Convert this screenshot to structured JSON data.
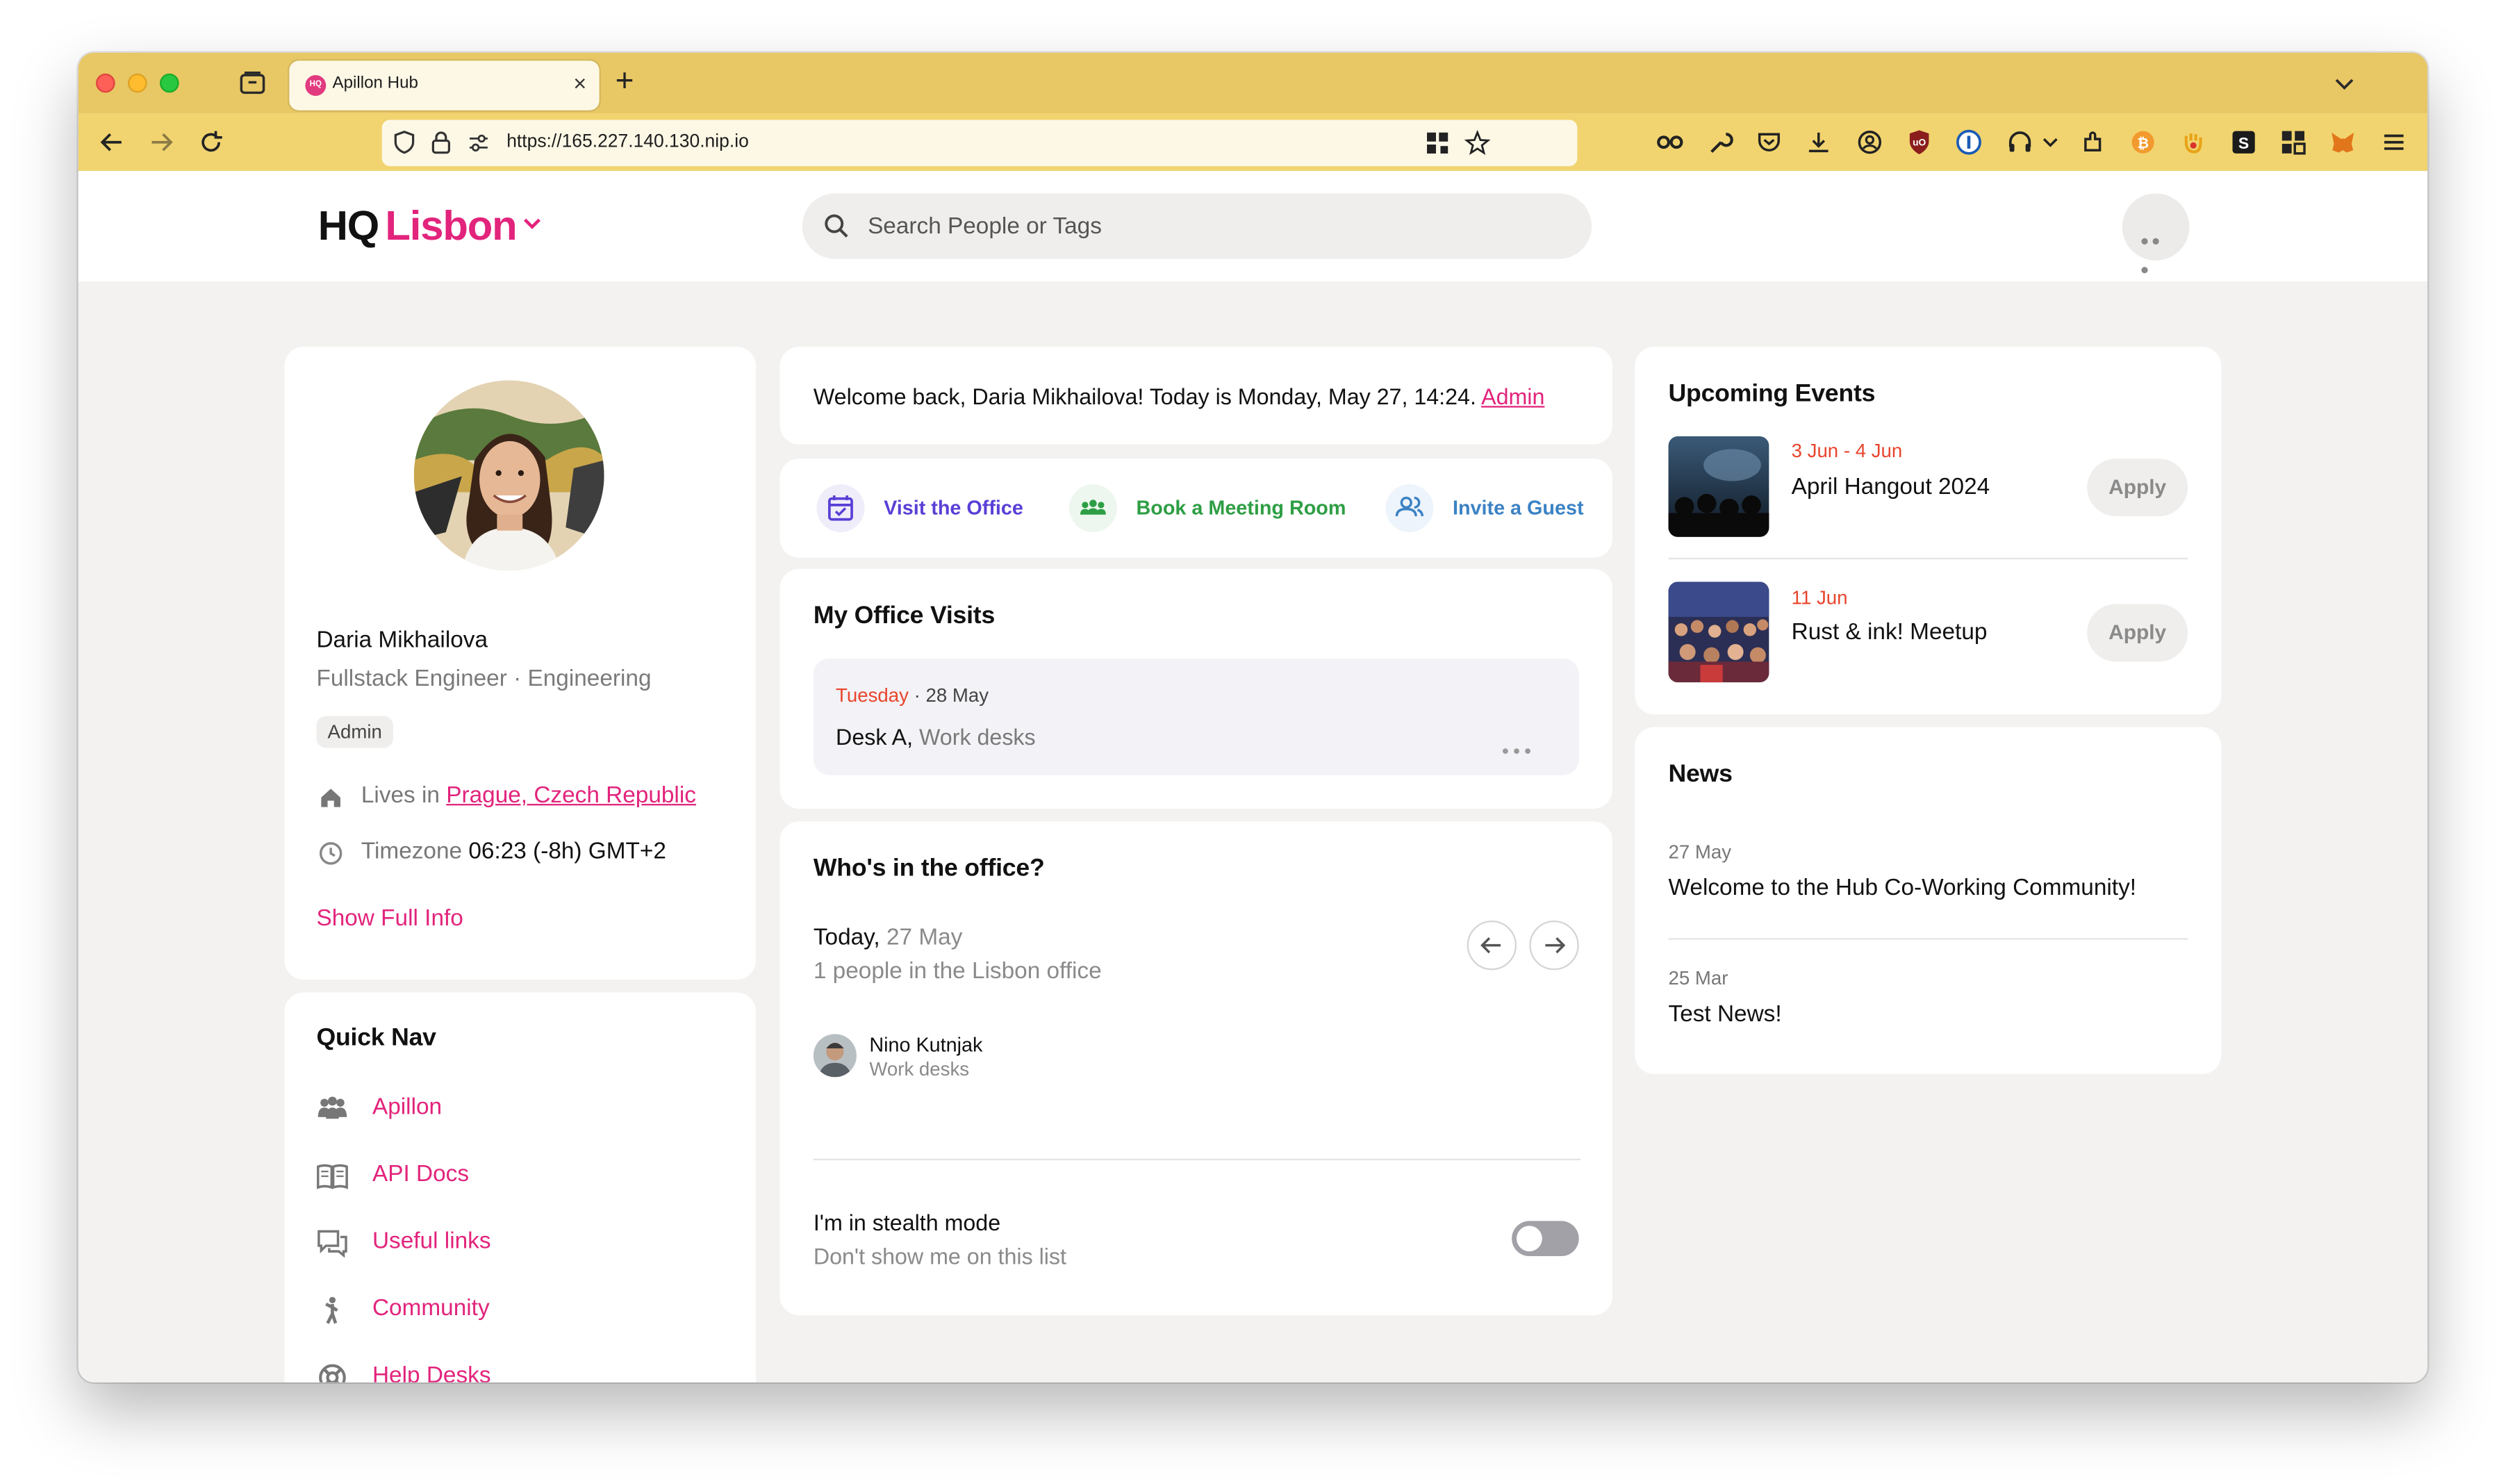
{
  "browser": {
    "tab_title": "Apillon Hub",
    "tab_favicon": "HQ",
    "url": "https://165.227.140.130.nip.io"
  },
  "header": {
    "logo_hq": "HQ",
    "logo_city": "Lisbon",
    "search_placeholder": "Search People or Tags"
  },
  "profile": {
    "name": "Daria Mikhailova",
    "role": "Fullstack Engineer · Engineering",
    "badge": "Admin",
    "lives_label": "Lives in",
    "lives_value": "Prague, Czech Republic",
    "timezone_label": "Timezone",
    "timezone_value": "06:23 (-8h) GMT+2",
    "show_full_info": "Show Full Info"
  },
  "quick_nav": {
    "title": "Quick Nav",
    "items": [
      {
        "label": "Apillon",
        "icon": "team-icon"
      },
      {
        "label": "API Docs",
        "icon": "book-icon"
      },
      {
        "label": "Useful links",
        "icon": "chat-icon"
      },
      {
        "label": "Community",
        "icon": "person-walking-icon"
      },
      {
        "label": "Help Desks",
        "icon": "lifebuoy-icon"
      }
    ]
  },
  "welcome": {
    "text": "Welcome back, Daria Mikhailova! Today is Monday, May 27, 14:24.",
    "admin_link": "Admin"
  },
  "actions": [
    {
      "label": "Visit the Office",
      "color": "#5a3fd6",
      "icon": "calendar-icon"
    },
    {
      "label": "Book a Meeting Room",
      "color": "#2e9e44",
      "icon": "group-icon"
    },
    {
      "label": "Invite a Guest",
      "color": "#3b82c4",
      "icon": "users-icon"
    }
  ],
  "office_visits": {
    "title": "My Office Visits",
    "visit": {
      "day": "Tuesday",
      "date": "· 28 May",
      "desk": "Desk A,",
      "area": "Work desks"
    }
  },
  "whos_in": {
    "title": "Who's in the office?",
    "today_label": "Today,",
    "today_date": "27 May",
    "count_text": "1 people in the Lisbon office",
    "people": [
      {
        "name": "Nino Kutnjak",
        "area": "Work desks"
      }
    ],
    "stealth_title": "I'm in stealth mode",
    "stealth_sub": "Don't show me on this list",
    "stealth_on": false
  },
  "events": {
    "title": "Upcoming Events",
    "items": [
      {
        "date": "3 Jun - 4 Jun",
        "name": "April Hangout 2024",
        "button": "Apply"
      },
      {
        "date": "11 Jun",
        "name": "Rust & ink! Meetup",
        "button": "Apply"
      }
    ]
  },
  "news": {
    "title": "News",
    "items": [
      {
        "date": "27 May",
        "title": "Welcome to the Hub Co-Working Community!"
      },
      {
        "date": "25 Mar",
        "title": "Test News!"
      }
    ]
  },
  "colors": {
    "accent": "#e2247c",
    "event_date": "#e8452c",
    "tab_strip": "#e8c765",
    "toolbar": "#f1d46f"
  }
}
